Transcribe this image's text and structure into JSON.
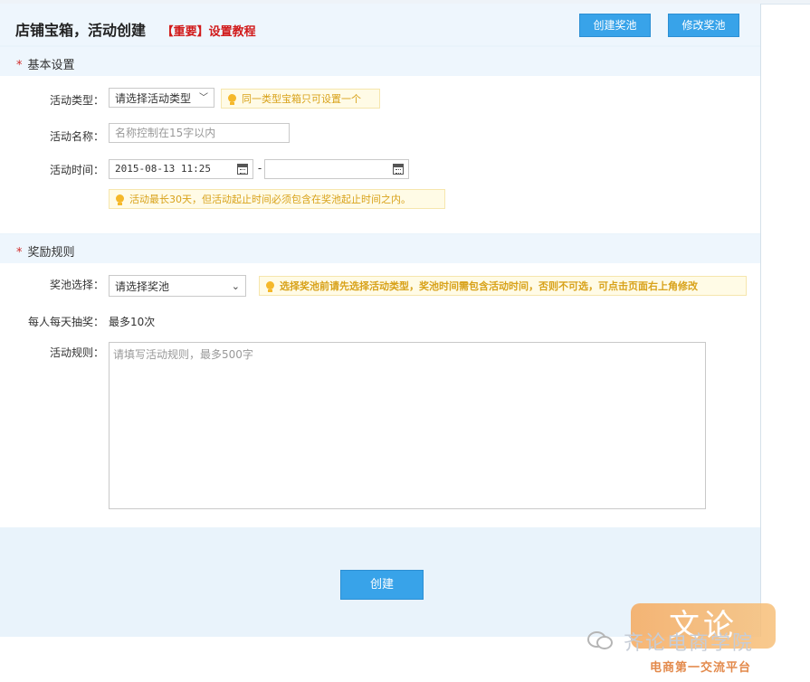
{
  "header": {
    "title": "店铺宝箱，活动创建",
    "tutorial_link": "【重要】设置教程",
    "create_pool_label": "创建奖池",
    "edit_pool_label": "修改奖池"
  },
  "basic": {
    "title": "基本设置",
    "type_label": "活动类型：",
    "type_value": "请选择活动类型",
    "type_tip": "同一类型宝箱只可设置一个",
    "name_label": "活动名称：",
    "name_placeholder": "名称控制在15字以内",
    "time_label": "活动时间：",
    "time_start": "2015-08-13 11:25",
    "time_sep": "-",
    "time_end": "",
    "time_tip": "活动最长30天，但活动起止时间必须包含在奖池起止时间之内。"
  },
  "reward": {
    "title": "奖励规则",
    "pool_label": "奖池选择：",
    "pool_value": "请选择奖池",
    "pool_tip_a": "选择奖池前请先选择活动类型，奖池时间需包含活动时间，",
    "pool_tip_b": "否则不可选",
    "pool_tip_c": "，可点击页面右上角修改",
    "daily_label": "每人每天抽奖：",
    "daily_value": "最多10次",
    "rules_label": "活动规则：",
    "rules_placeholder": "请填写活动规则，最多500字"
  },
  "footer": {
    "create_label": "创建"
  },
  "watermark": {
    "badge": "文论",
    "name": "齐论电商学院",
    "subtitle": "电商第一交流平台"
  }
}
